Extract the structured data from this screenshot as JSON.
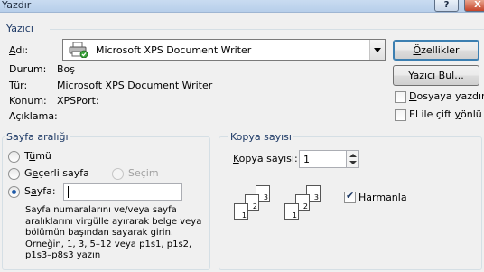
{
  "window": {
    "title": "Yazdır",
    "help_glyph": "?",
    "close_glyph": "X"
  },
  "printer": {
    "group_label": "Yazıcı",
    "name_label": "Adı:",
    "selected_printer": "Microsoft XPS Document Writer",
    "status_label": "Durum:",
    "status_value": "Boş",
    "type_label": "Tür:",
    "type_value": "Microsoft XPS Document Writer",
    "location_label": "Konum:",
    "location_value": "XPSPort:",
    "comment_label": "Açıklama:",
    "comment_value": "",
    "properties_button": "Özellikler",
    "find_printer_button": "Yazıcı Bul...",
    "print_to_file_label": "Dosyaya yazdır",
    "print_to_file_checked": false,
    "duplex_label": "El ile çift yönlü",
    "duplex_checked": false
  },
  "page_range": {
    "group_label": "Sayfa aralığı",
    "all_label": "Tümü",
    "current_label": "Geçerli sayfa",
    "selection_label": "Seçim",
    "pages_label": "Sayfa:",
    "pages_value": "",
    "selected_option": "pages",
    "hint": "Sayfa numaralarını ve/veya sayfa aralıklarını virgülle ayırarak belge veya bölümün başından sayarak girin. Örneğin, 1, 3, 5–12 veya p1s1, p1s2, p1s3–p8s3 yazın"
  },
  "copies": {
    "group_label": "Kopya sayısı",
    "count_label": "Kopya sayısı:",
    "count_value": "1",
    "collate_label": "Harmanla",
    "collate_checked": true,
    "page_numbers": [
      "1",
      "2",
      "3"
    ]
  }
}
